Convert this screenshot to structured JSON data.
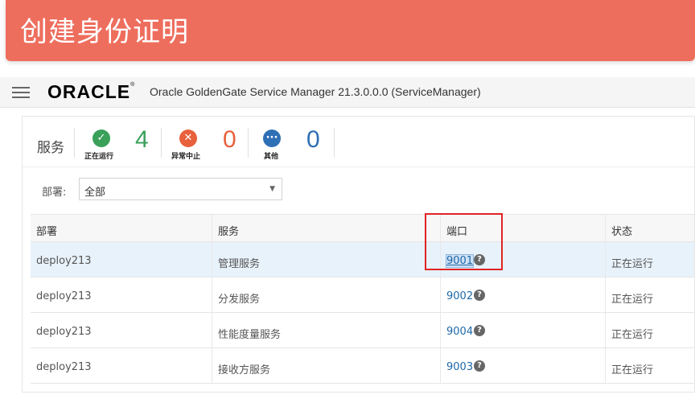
{
  "banner": {
    "title": "创建身份证明"
  },
  "appbar": {
    "logo": "ORACLE",
    "logo_mark": "®",
    "title": "Oracle GoldenGate Service Manager 21.3.0.0.0 (ServiceManager)"
  },
  "summary": {
    "label": "服务",
    "stats": [
      {
        "count": "4",
        "caption": "正在运行",
        "icon": "check-icon",
        "color": "#3aa05a"
      },
      {
        "count": "0",
        "caption": "异常中止",
        "icon": "close-icon",
        "color": "#e8603c"
      },
      {
        "count": "0",
        "caption": "其他",
        "icon": "more-icon",
        "color": "#2f6fb5"
      }
    ]
  },
  "filter": {
    "label": "部署:",
    "value": "全部"
  },
  "table": {
    "headers": [
      "部署",
      "服务",
      "端口",
      "状态"
    ],
    "rows": [
      {
        "deployment": "deploy213",
        "service": "管理服务",
        "port": "9001",
        "status": "正在运行"
      },
      {
        "deployment": "deploy213",
        "service": "分发服务",
        "port": "9002",
        "status": "正在运行"
      },
      {
        "deployment": "deploy213",
        "service": "性能度量服务",
        "port": "9004",
        "status": "正在运行"
      },
      {
        "deployment": "deploy213",
        "service": "接收方服务",
        "port": "9003",
        "status": "正在运行"
      }
    ]
  },
  "colors": {
    "banner": "#ee6e5e",
    "link": "#1d68a8",
    "highlight_box": "#e02424"
  }
}
